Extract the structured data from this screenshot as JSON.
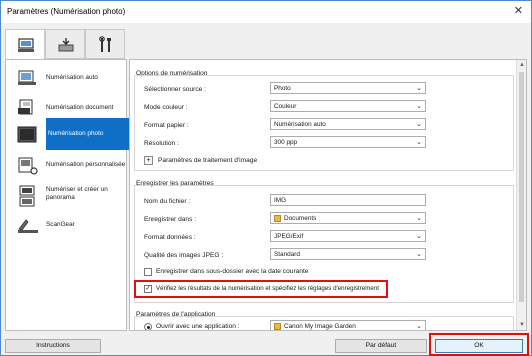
{
  "window": {
    "title": "Paramètres (Numérisation photo)",
    "close_glyph": "✕"
  },
  "tabs": [
    {
      "icon": "scanner-computer-icon",
      "active": true
    },
    {
      "icon": "scanner-save-icon",
      "active": false
    },
    {
      "icon": "tools-icon",
      "active": false
    }
  ],
  "sidebar": {
    "items": [
      {
        "label": "Numérisation auto",
        "icon": "auto-scan-icon"
      },
      {
        "label": "Numérisation document",
        "icon": "document-scan-icon"
      },
      {
        "label": "Numérisation photo",
        "icon": "photo-scan-icon",
        "active": true
      },
      {
        "label": "Numérisation personnalisée",
        "icon": "custom-scan-icon"
      },
      {
        "label": "Numériser et créer un panorama",
        "line1": "Numériser et créer un",
        "line2": "panorama",
        "icon": "panorama-icon"
      },
      {
        "label": "ScanGear",
        "icon": "scangear-icon"
      }
    ]
  },
  "scan_options": {
    "title": "Options de numérisation",
    "source_label": "Sélectionner source :",
    "source_value": "Photo",
    "color_label": "Mode couleur :",
    "color_value": "Couleur",
    "paper_label": "Format papier :",
    "paper_value": "Numérisation auto",
    "resolution_label": "Résolution :",
    "resolution_value": "300 ppp",
    "image_processing_label": "Paramètres de traitement d'image",
    "plus_glyph": "+"
  },
  "save_settings": {
    "title": "Enregistrer les paramètres",
    "filename_label": "Nom du fichier :",
    "filename_value": "IMG",
    "save_in_label": "Enregistrer dans :",
    "save_in_value": "Documents",
    "format_label": "Format données :",
    "format_value": "JPEG/Exif",
    "quality_label": "Qualité des images JPEG :",
    "quality_value": "Standard",
    "subfolder_label": "Enregistrer dans sous-dossier avec la date courante",
    "subfolder_checked": false,
    "verify_label": "Vérifiez les résultats de la numérisation et spécifiez les réglages d'enregistrement",
    "verify_checked": true,
    "check_glyph": "✓"
  },
  "app_settings": {
    "title": "Paramètres de l'application",
    "open_with_label": "Ouvrir avec une application :",
    "open_with_value": "Canon My Image Garden"
  },
  "footer": {
    "instructions": "Instructions",
    "defaults": "Par défaut",
    "ok": "OK"
  },
  "dropdown_glyph": "⌄",
  "colors": {
    "accent": "#0f6fc6",
    "highlight": "#e01010"
  }
}
